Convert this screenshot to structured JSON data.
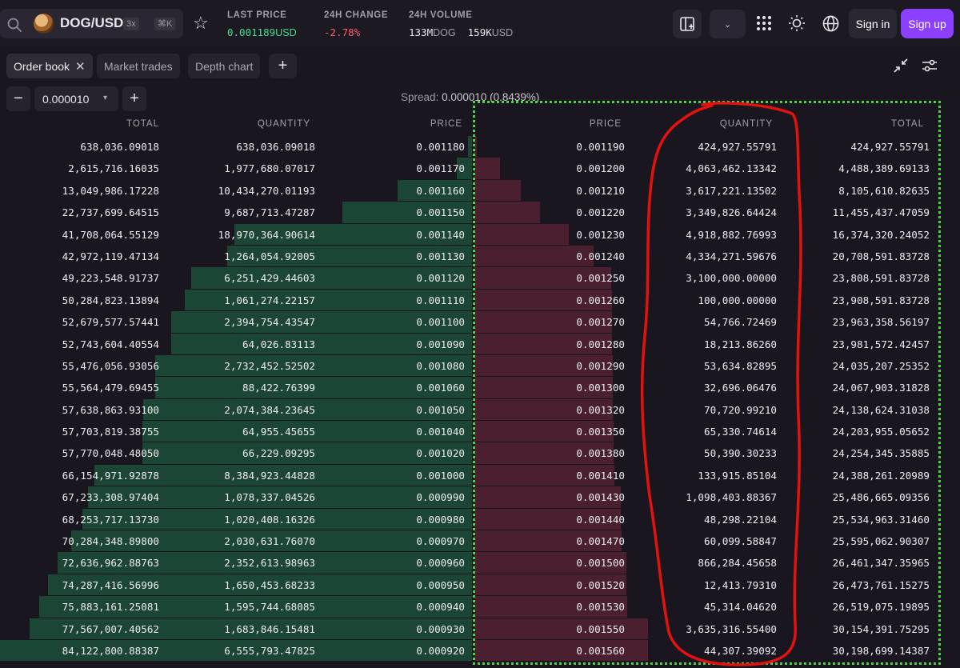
{
  "header": {
    "pair": "DOG/USD",
    "leverage": "3x",
    "shortcut": "⌘K",
    "last_price_label": "LAST PRICE",
    "last_price_value": "0.001189",
    "last_price_unit": "USD",
    "change_label": "24H CHANGE",
    "change_value": "-2.78",
    "change_pct": "%",
    "volume_label": "24H VOLUME",
    "volume_base": "133M",
    "volume_base_unit": "DOG",
    "volume_quote": "159K",
    "volume_quote_unit": "USD",
    "sign_in": "Sign in",
    "sign_up": "Sign up",
    "colors": {
      "accent": "#8b3fff",
      "bid": "#3ee08f",
      "ask": "#ff5d6e"
    }
  },
  "tabs": [
    {
      "label": "Order book",
      "active": true
    },
    {
      "label": "Market trades",
      "active": false
    },
    {
      "label": "Depth chart",
      "active": false
    }
  ],
  "controls": {
    "step_value": "0.000010",
    "spread_label": "Spread:",
    "spread_value": "0.000010 (0.8439%)"
  },
  "columns": {
    "bid_total": "TOTAL",
    "bid_quantity": "QUANTITY",
    "bid_price": "PRICE",
    "ask_price": "PRICE",
    "ask_quantity": "QUANTITY",
    "ask_total": "TOTAL"
  },
  "rows": [
    {
      "bid_total": "638,036.09018",
      "bid_qty": "638,036.09018",
      "bid_price": "0.001180",
      "bid_depth": 0.0076,
      "ask_price": "0.001190",
      "ask_qty": "424,927.55791",
      "ask_total": "424,927.55791",
      "ask_depth": 0.014
    },
    {
      "bid_total": "2,615,716.16035",
      "bid_qty": "1,977,680.07017",
      "bid_price": "0.001170",
      "bid_depth": 0.0311,
      "ask_price": "0.001200",
      "ask_qty": "4,063,462.13342",
      "ask_total": "4,488,389.69133",
      "ask_depth": 0.1486
    },
    {
      "bid_total": "13,049,986.17228",
      "bid_qty": "10,434,270.01193",
      "bid_price": "0.001160",
      "bid_depth": 0.1551,
      "ask_price": "0.001210",
      "ask_qty": "3,617,221.13502",
      "ask_total": "8,105,610.82635",
      "ask_depth": 0.2684
    },
    {
      "bid_total": "22,737,699.64515",
      "bid_qty": "9,687,713.47287",
      "bid_price": "0.001150",
      "bid_depth": 0.2703,
      "ask_price": "0.001220",
      "ask_qty": "3,349,826.64424",
      "ask_total": "11,455,437.47059",
      "ask_depth": 0.3793
    },
    {
      "bid_total": "41,708,064.55129",
      "bid_qty": "18,970,364.90614",
      "bid_price": "0.001140",
      "bid_depth": 0.4958,
      "ask_price": "0.001230",
      "ask_qty": "4,918,882.76993",
      "ask_total": "16,374,320.24052",
      "ask_depth": 0.5422
    },
    {
      "bid_total": "42,972,119.47134",
      "bid_qty": "1,264,054.92005",
      "bid_price": "0.001130",
      "bid_depth": 0.5108,
      "ask_price": "0.001240",
      "ask_qty": "4,334,271.59676",
      "ask_total": "20,708,591.83728",
      "ask_depth": 0.6858
    },
    {
      "bid_total": "49,223,548.91737",
      "bid_qty": "6,251,429.44603",
      "bid_price": "0.001120",
      "bid_depth": 0.5851,
      "ask_price": "0.001250",
      "ask_qty": "3,100,000.00000",
      "ask_total": "23,808,591.83728",
      "ask_depth": 0.7884
    },
    {
      "bid_total": "50,284,823.13894",
      "bid_qty": "1,061,274.22157",
      "bid_price": "0.001110",
      "bid_depth": 0.5977,
      "ask_price": "0.001260",
      "ask_qty": "100,000.00000",
      "ask_total": "23,908,591.83728",
      "ask_depth": 0.7917
    },
    {
      "bid_total": "52,679,577.57441",
      "bid_qty": "2,394,754.43547",
      "bid_price": "0.001100",
      "bid_depth": 0.6262,
      "ask_price": "0.001270",
      "ask_qty": "54,766.72469",
      "ask_total": "23,963,358.56197",
      "ask_depth": 0.7936
    },
    {
      "bid_total": "52,743,604.40554",
      "bid_qty": "64,026.83113",
      "bid_price": "0.001090",
      "bid_depth": 0.627,
      "ask_price": "0.001280",
      "ask_qty": "18,213.86260",
      "ask_total": "23,981,572.42457",
      "ask_depth": 0.7942
    },
    {
      "bid_total": "55,476,056.93056",
      "bid_qty": "2,732,452.52502",
      "bid_price": "0.001080",
      "bid_depth": 0.6595,
      "ask_price": "0.001290",
      "ask_qty": "53,634.82895",
      "ask_total": "24,035,207.25352",
      "ask_depth": 0.7959
    },
    {
      "bid_total": "55,564,479.69455",
      "bid_qty": "88,422.76399",
      "bid_price": "0.001060",
      "bid_depth": 0.6605,
      "ask_price": "0.001300",
      "ask_qty": "32,696.06476",
      "ask_total": "24,067,903.31828",
      "ask_depth": 0.797
    },
    {
      "bid_total": "57,638,863.93100",
      "bid_qty": "2,074,384.23645",
      "bid_price": "0.001050",
      "bid_depth": 0.6852,
      "ask_price": "0.001320",
      "ask_qty": "70,720.99210",
      "ask_total": "24,138,624.31038",
      "ask_depth": 0.7993
    },
    {
      "bid_total": "57,703,819.38755",
      "bid_qty": "64,955.45655",
      "bid_price": "0.001040",
      "bid_depth": 0.6859,
      "ask_price": "0.001350",
      "ask_qty": "65,330.74614",
      "ask_total": "24,203,955.05652",
      "ask_depth": 0.8015
    },
    {
      "bid_total": "57,770,048.48050",
      "bid_qty": "66,229.09295",
      "bid_price": "0.001020",
      "bid_depth": 0.6867,
      "ask_price": "0.001380",
      "ask_qty": "50,390.30233",
      "ask_total": "24,254,345.35885",
      "ask_depth": 0.8032
    },
    {
      "bid_total": "66,154,971.92878",
      "bid_qty": "8,384,923.44828",
      "bid_price": "0.001000",
      "bid_depth": 0.7864,
      "ask_price": "0.001410",
      "ask_qty": "133,915.85104",
      "ask_total": "24,388,261.20989",
      "ask_depth": 0.8076
    },
    {
      "bid_total": "67,233,308.97404",
      "bid_qty": "1,078,337.04526",
      "bid_price": "0.000990",
      "bid_depth": 0.7992,
      "ask_price": "0.001430",
      "ask_qty": "1,098,403.88367",
      "ask_total": "25,486,665.09356",
      "ask_depth": 0.844
    },
    {
      "bid_total": "68,253,717.13730",
      "bid_qty": "1,020,408.16326",
      "bid_price": "0.000980",
      "bid_depth": 0.8113,
      "ask_price": "0.001440",
      "ask_qty": "48,298.22104",
      "ask_total": "25,534,963.31460",
      "ask_depth": 0.8456
    },
    {
      "bid_total": "70,284,348.89800",
      "bid_qty": "2,030,631.76070",
      "bid_price": "0.000970",
      "bid_depth": 0.8355,
      "ask_price": "0.001470",
      "ask_qty": "60,099.58847",
      "ask_total": "25,595,062.90307",
      "ask_depth": 0.8476
    },
    {
      "bid_total": "72,636,962.88763",
      "bid_qty": "2,352,613.98963",
      "bid_price": "0.000960",
      "bid_depth": 0.8635,
      "ask_price": "0.001500",
      "ask_qty": "866,284.45658",
      "ask_total": "26,461,347.35965",
      "ask_depth": 0.8763
    },
    {
      "bid_total": "74,287,416.56996",
      "bid_qty": "1,650,453.68233",
      "bid_price": "0.000950",
      "bid_depth": 0.8831,
      "ask_price": "0.001520",
      "ask_qty": "12,413.79310",
      "ask_total": "26,473,761.15275",
      "ask_depth": 0.8767
    },
    {
      "bid_total": "75,883,161.25081",
      "bid_qty": "1,595,744.68085",
      "bid_price": "0.000940",
      "bid_depth": 0.902,
      "ask_price": "0.001530",
      "ask_qty": "45,314.04620",
      "ask_total": "26,519,075.19895",
      "ask_depth": 0.8782
    },
    {
      "bid_total": "77,567,007.40562",
      "bid_qty": "1,683,846.15481",
      "bid_price": "0.000930",
      "bid_depth": 0.9221,
      "ask_price": "0.001550",
      "ask_qty": "3,635,316.55400",
      "ask_total": "30,154,391.75295",
      "ask_depth": 0.9986
    },
    {
      "bid_total": "84,122,800.88387",
      "bid_qty": "6,555,793.47825",
      "bid_price": "0.000920",
      "bid_depth": 1.0,
      "ask_price": "0.001560",
      "ask_qty": "44,307.39092",
      "ask_total": "30,198,699.14387",
      "ask_depth": 1.0
    }
  ]
}
